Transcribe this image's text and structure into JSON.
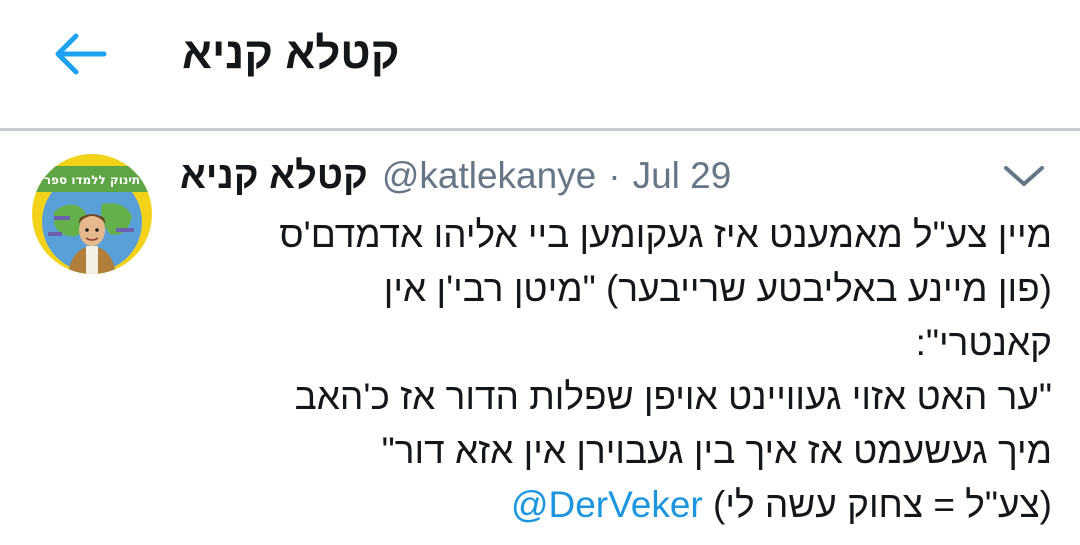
{
  "header": {
    "title": "קטלא קניא",
    "back_icon": "arrow-left-icon"
  },
  "tweet": {
    "author_name": "קטלא קניא",
    "handle": "@katlekanye",
    "separator": "·",
    "date": "Jul 29",
    "more_icon": "chevron-down-icon",
    "avatar_text": "תינוק ללמדו ספר",
    "lines": [
      "מיין צע\"ל מאמענט איז געקומען ביי אליהו אדמדם'ס",
      "(פון מיינע באליבטע שרייבער) \"מיטן רבי'ן אין",
      "קאנטרי\":",
      "\"ער האט אזוי געוויינט אויפן שפלות הדור אז כ'האב",
      "מיך געשעמט אז איך בין געבוירן אין אזא דור\""
    ],
    "last_line_text": "(צע\"ל = צחוק עשה לי)",
    "mention": "@DerVeker"
  },
  "colors": {
    "accent": "#1da1f2",
    "mention": "#1b95e0",
    "secondary_text": "#657786",
    "divider": "#c7ccd1"
  }
}
